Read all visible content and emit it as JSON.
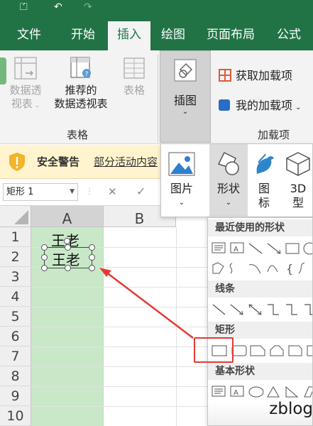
{
  "titlebar": {
    "glyphs": [
      "⏍",
      "↶",
      "↷"
    ]
  },
  "tabs": [
    {
      "label": "文件"
    },
    {
      "label": "开始"
    },
    {
      "label": "插入"
    },
    {
      "label": "绘图"
    },
    {
      "label": "页面布局"
    },
    {
      "label": "公式"
    }
  ],
  "ribbon": {
    "pivot": {
      "line1": "数据透",
      "line2": "视表"
    },
    "recommended": {
      "line1": "推荐的",
      "line2": "数据透视表"
    },
    "table": {
      "label": "表格"
    },
    "group_tables": "表格",
    "illustrations": {
      "label": "插图"
    },
    "get_addins": "获取加载项",
    "my_addins": "我的加载项",
    "group_addins": "加载项"
  },
  "warning": {
    "title": "安全警告",
    "text": "部分活动内容"
  },
  "formula": {
    "namebox": "矩形 1",
    "cancel": "✕",
    "enter": "✓"
  },
  "grid": {
    "columns": [
      "A",
      "B"
    ],
    "rows": [
      "1",
      "2",
      "3",
      "4",
      "5",
      "6",
      "7",
      "8",
      "9",
      "10"
    ],
    "cell_a1": "王老",
    "shape_text": "王老"
  },
  "illustrations_menu": {
    "picture": "图片",
    "shapes": "形状",
    "icons": {
      "line1": "图",
      "line2": "标"
    },
    "models": {
      "line1": "3D",
      "line2": "型"
    }
  },
  "shapes_menu": {
    "recent": "最近使用的形状",
    "lines": "线条",
    "rectangles": "矩形",
    "basic": "基本形状"
  },
  "watermark": "zblog",
  "colors": {
    "accent": "#217346",
    "warning_bg": "#fff4ce",
    "column_highlight": "#c8e8c8",
    "annotation_red": "#e53935"
  }
}
